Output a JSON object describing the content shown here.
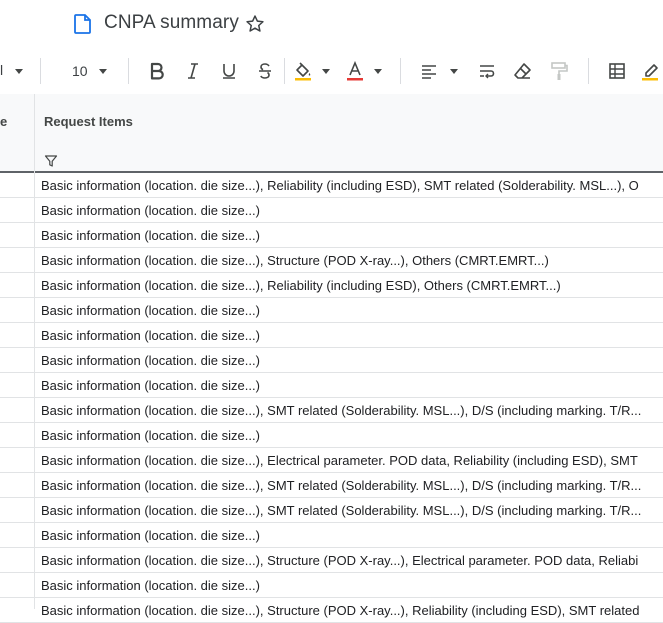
{
  "document": {
    "title": "CNPA summary"
  },
  "toolbar": {
    "font_stub": "l",
    "font_size": "10"
  },
  "header": {
    "left_stub": "e",
    "column_title": "Request Items"
  },
  "rows": [
    "Basic information (location. die size...), Reliability (including ESD), SMT related (Solderability. MSL...), O",
    "Basic information (location. die size...)",
    "Basic information (location. die size...)",
    "Basic information (location. die size...), Structure (POD X-ray...), Others (CMRT.EMRT...)",
    "Basic information (location. die size...), Reliability (including ESD), Others (CMRT.EMRT...)",
    "Basic information (location. die size...)",
    "Basic information (location. die size...)",
    "Basic information (location. die size...)",
    "Basic information (location. die size...)",
    "Basic information (location. die size...), SMT related (Solderability. MSL...), D/S (including marking. T/R...",
    "Basic information (location. die size...)",
    "Basic information (location. die size...), Electrical parameter. POD data, Reliability (including ESD), SMT",
    "Basic information (location. die size...), SMT related (Solderability. MSL...), D/S (including marking. T/R...",
    "Basic information (location. die size...), SMT related (Solderability. MSL...), D/S (including marking. T/R...",
    "Basic information (location. die size...)",
    "Basic information (location. die size...), Structure (POD X-ray...), Electrical parameter. POD data, Reliabi",
    "Basic information (location. die size...)",
    "Basic information (location. die size...), Structure (POD X-ray...), Reliability (including ESD), SMT related"
  ],
  "colors": {
    "text_color_underline": "#e53935",
    "highlight_underline": "#fbbc04",
    "doc_icon_blue": "#1a73e8"
  }
}
